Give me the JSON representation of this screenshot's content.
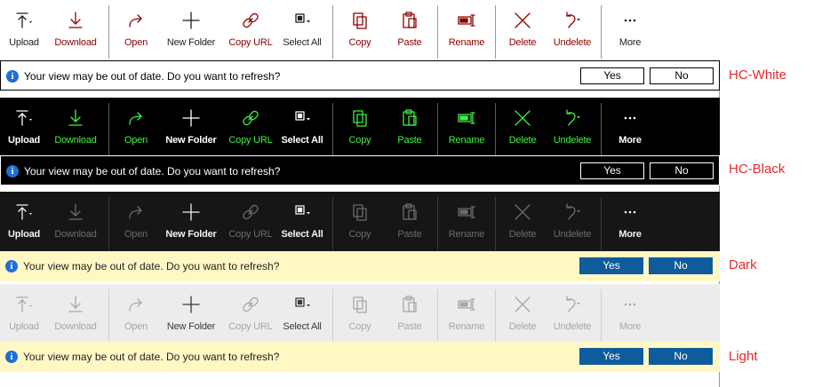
{
  "toolbar": {
    "buttons": [
      {
        "id": "upload",
        "label": "Upload",
        "icon": "upload-icon"
      },
      {
        "id": "download",
        "label": "Download",
        "icon": "download-icon"
      },
      {
        "id": "open",
        "label": "Open",
        "icon": "open-icon"
      },
      {
        "id": "new-folder",
        "label": "New Folder",
        "icon": "plus-icon"
      },
      {
        "id": "copy-url",
        "label": "Copy URL",
        "icon": "link-icon"
      },
      {
        "id": "select-all",
        "label": "Select All",
        "icon": "select-all-icon"
      },
      {
        "id": "copy",
        "label": "Copy",
        "icon": "copy-icon"
      },
      {
        "id": "paste",
        "label": "Paste",
        "icon": "paste-icon"
      },
      {
        "id": "rename",
        "label": "Rename",
        "icon": "rename-icon"
      },
      {
        "id": "delete",
        "label": "Delete",
        "icon": "delete-icon"
      },
      {
        "id": "undelete",
        "label": "Undelete",
        "icon": "undelete-icon"
      },
      {
        "id": "more",
        "label": "More",
        "icon": "more-icon"
      }
    ]
  },
  "notification": {
    "message": "Your view may be out of date. Do you want to refresh?",
    "yes_label": "Yes",
    "no_label": "No"
  },
  "themes": [
    {
      "label": "HC-White",
      "bg": "#ffffff",
      "active_color": "#8b0000",
      "disabled_color": "#8b0000",
      "neutral_color": "#1f1f1f",
      "bar_bg": "#ffffff",
      "bar_text": "#000000",
      "btn_bg": "#ffffff",
      "btn_text": "#000000",
      "btn_border": "#000000",
      "sep": "#9a9a9a",
      "info_bg": "#1e6fd9"
    },
    {
      "label": "HC-Black",
      "bg": "#000000",
      "active_color": "#3ff23f",
      "disabled_color": "#3ff23f",
      "neutral_color": "#ffffff",
      "bar_bg": "#000000",
      "bar_text": "#ffffff",
      "btn_bg": "#000000",
      "btn_text": "#ffffff",
      "btn_border": "#ffffff",
      "sep": "#5a5a5a",
      "info_bg": "#1e6fd9"
    },
    {
      "label": "Dark",
      "bg": "#161616",
      "active_color": "#6b6b6b",
      "disabled_color": "#5c5c5c",
      "neutral_color": "#f2f2f2",
      "bar_bg": "#fff8c5",
      "bar_text": "#222222",
      "btn_bg": "#0e5c9b",
      "btn_text": "#ffffff",
      "btn_border": "#0e5c9b",
      "sep": "#3a3a3a",
      "info_bg": "#1e6fd9"
    },
    {
      "label": "Light",
      "bg": "#ececec",
      "active_color": "#a7a7a7",
      "disabled_color": "#a7a7a7",
      "neutral_color": "#3a3a3a",
      "bar_bg": "#fff8c5",
      "bar_text": "#222222",
      "btn_bg": "#0e5c9b",
      "btn_text": "#ffffff",
      "btn_border": "#0e5c9b",
      "sep": "#cfcfcf",
      "info_bg": "#1e6fd9"
    }
  ]
}
